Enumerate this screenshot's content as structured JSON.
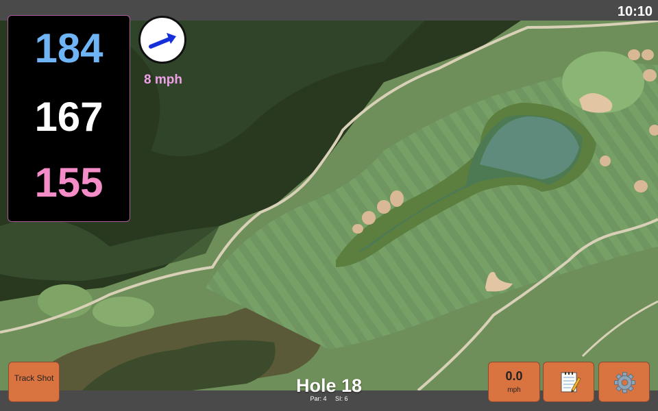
{
  "status": {
    "time": "10:10"
  },
  "distances": {
    "back": "184",
    "middle": "167",
    "front": "155",
    "back_color": "#6fb4f5",
    "middle_color": "#ffffff",
    "front_color": "#f48cc8"
  },
  "wind": {
    "speed": "8 mph",
    "icon": "wind-direction-arrow-icon",
    "color": "#f0a0e8"
  },
  "buttons": {
    "track_shot": "Track Shot",
    "speed_value": "0.0",
    "speed_unit": "mph",
    "notes_icon": "notepad-icon",
    "settings_icon": "gear-icon",
    "accent": "#d9733f"
  },
  "hole": {
    "title": "Hole 18",
    "par": "Par: 4",
    "si": "SI: 6"
  },
  "map": {
    "type": "satellite-golf-hole"
  }
}
